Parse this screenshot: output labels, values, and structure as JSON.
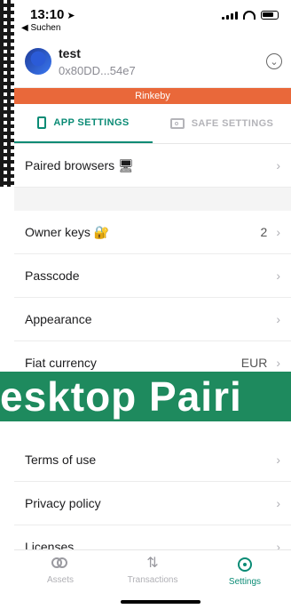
{
  "status_bar": {
    "time": "13:10",
    "back_label": "◀ Suchen"
  },
  "safe": {
    "name": "test",
    "address": "0x80DD...54e7"
  },
  "network": {
    "label": "Rinkeby"
  },
  "tabs": {
    "app": "APP SETTINGS",
    "safe": "SAFE SETTINGS"
  },
  "rows": {
    "paired": {
      "label": "Paired browsers"
    },
    "owner_keys": {
      "label": "Owner keys",
      "value": "2"
    },
    "passcode": {
      "label": "Passcode"
    },
    "appearance": {
      "label": "Appearance"
    },
    "fiat": {
      "label": "Fiat currency",
      "value": "EUR"
    },
    "terms": {
      "label": "Terms of use"
    },
    "privacy": {
      "label": "Privacy policy"
    },
    "licenses": {
      "label": "Licenses"
    }
  },
  "banner": {
    "text": "esktop Pairi"
  },
  "bottom_nav": {
    "assets": "Assets",
    "transactions": "Transactions",
    "settings": "Settings"
  },
  "colors": {
    "accent": "#0a8b75",
    "network": "#e9683a",
    "banner": "#1e8a5e"
  }
}
